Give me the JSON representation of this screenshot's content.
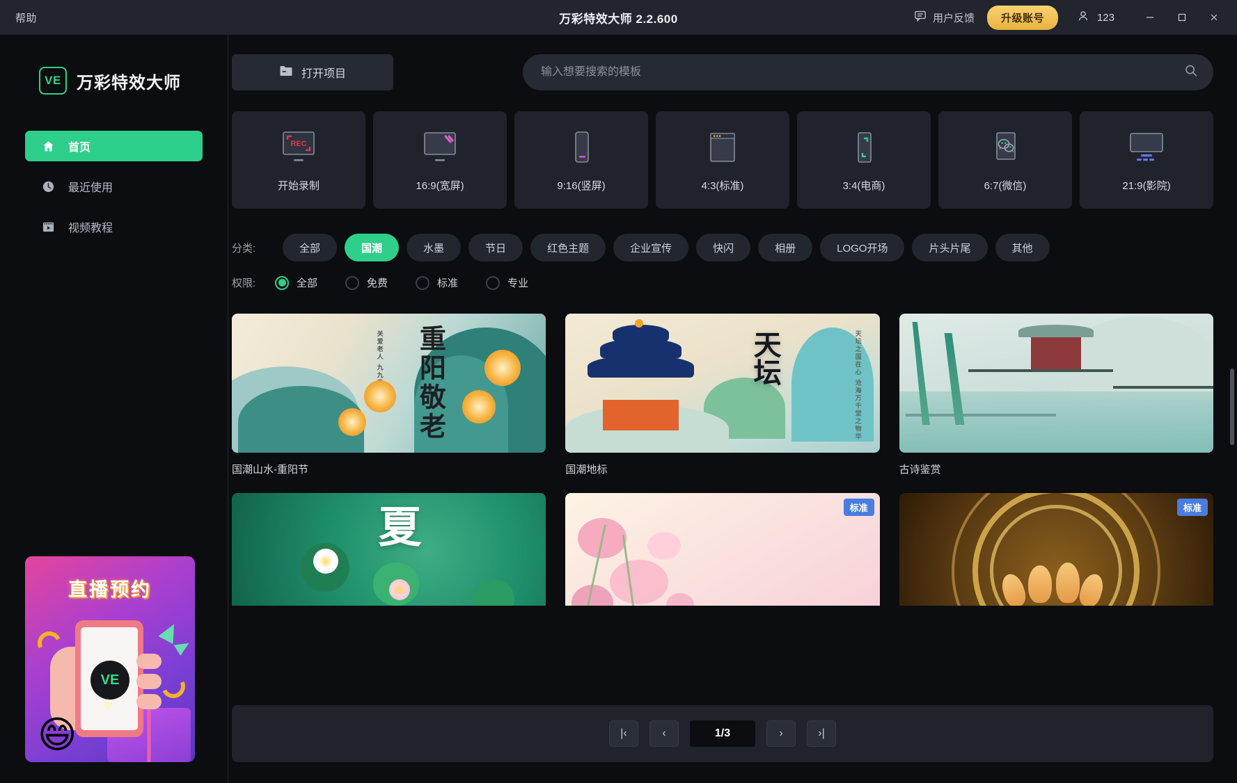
{
  "titlebar": {
    "help_label": "帮助",
    "app_title": "万彩特效大师 2.2.600",
    "feedback_label": "用户反馈",
    "feedback_icon": "comment-icon",
    "upgrade_label": "升级账号",
    "user_name": "123",
    "user_icon": "user-icon",
    "minimize_glyph": "—",
    "maximize_glyph": "▢",
    "close_glyph": "✕"
  },
  "sidebar": {
    "brand_mark": "VE",
    "brand_name": "万彩特效大师",
    "items": [
      {
        "label": "首页",
        "icon": "home-icon",
        "active": true
      },
      {
        "label": "最近使用",
        "icon": "clock-icon",
        "active": false
      },
      {
        "label": "视频教程",
        "icon": "video-icon",
        "active": false
      }
    ],
    "promo": {
      "title": "直播预约",
      "phone_logo": "VE"
    }
  },
  "toolbar": {
    "open_project_label": "打开项目",
    "open_project_icon": "folder-icon",
    "search_placeholder": "输入想要搜索的模板",
    "search_value": "",
    "search_icon": "search-icon"
  },
  "presets": [
    {
      "label": "开始录制",
      "icon": "record-screen-icon",
      "accent": "#e0364a"
    },
    {
      "label": "16:9(宽屏)",
      "icon": "monitor-icon",
      "accent": "#e25fd0"
    },
    {
      "label": "9:16(竖屏)",
      "icon": "phone-portrait-icon",
      "accent": "#d050d8"
    },
    {
      "label": "4:3(标准)",
      "icon": "window-icon",
      "accent": "#e0a640"
    },
    {
      "label": "3:4(电商)",
      "icon": "tablet-crop-icon",
      "accent": "#2ecf8a"
    },
    {
      "label": "6:7(微信)",
      "icon": "wechat-icon",
      "accent": "#2ecf8a"
    },
    {
      "label": "21:9(影院)",
      "icon": "cinema-icon",
      "accent": "#6275e8"
    }
  ],
  "filters": {
    "category_label": "分类:",
    "categories": [
      {
        "label": "全部",
        "active": false
      },
      {
        "label": "国潮",
        "active": true
      },
      {
        "label": "水墨",
        "active": false
      },
      {
        "label": "节日",
        "active": false
      },
      {
        "label": "红色主题",
        "active": false
      },
      {
        "label": "企业宣传",
        "active": false
      },
      {
        "label": "快闪",
        "active": false
      },
      {
        "label": "相册",
        "active": false
      },
      {
        "label": "LOGO开场",
        "active": false
      },
      {
        "label": "片头片尾",
        "active": false
      },
      {
        "label": "其他",
        "active": false
      }
    ],
    "permission_label": "权限:",
    "permissions": [
      {
        "label": "全部",
        "selected": true
      },
      {
        "label": "免费",
        "selected": false
      },
      {
        "label": "标准",
        "selected": false
      },
      {
        "label": "专业",
        "selected": false
      }
    ]
  },
  "templates": [
    {
      "title": "国潮山水-重阳节",
      "badge": "",
      "art": "chongyang",
      "art_text": "重阳敬老",
      "art_sub": "关爱老人 九九重阳节"
    },
    {
      "title": "国潮地标",
      "badge": "",
      "art": "tiantan",
      "art_text": "天坛",
      "art_sub": "天坛之国在心 沧海万千堂之物华"
    },
    {
      "title": "古诗鉴赏",
      "badge": "",
      "art": "gushi",
      "art_text": "",
      "art_sub": ""
    },
    {
      "title": "",
      "badge": "",
      "art": "xia",
      "art_text": "夏",
      "art_sub": ""
    },
    {
      "title": "",
      "badge": "标准",
      "art": "sakura",
      "art_text": "",
      "art_sub": ""
    },
    {
      "title": "",
      "badge": "标准",
      "art": "gold",
      "art_text": "",
      "art_sub": ""
    }
  ],
  "pagination": {
    "first_glyph": "|‹",
    "prev_glyph": "‹",
    "current": "1/3",
    "next_glyph": "›",
    "last_glyph": "›|"
  },
  "colors": {
    "accent_green": "#2ecf8a",
    "upgrade_gold": "#e8b440",
    "badge_blue": "#4a7de0",
    "window_bg": "#0c0d10",
    "panel_bg": "#20232c",
    "titlebar_bg": "#22252d"
  }
}
